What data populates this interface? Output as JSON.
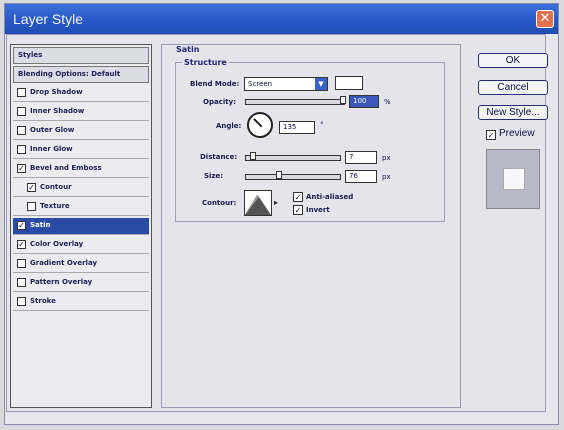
{
  "window": {
    "title": "Layer Style",
    "close_icon": "✕"
  },
  "sidebar": {
    "styles_header": "Styles",
    "blending_header": "Blending Options: Default",
    "items": [
      {
        "label": "Drop Shadow",
        "checked": false
      },
      {
        "label": "Inner Shadow",
        "checked": false
      },
      {
        "label": "Outer Glow",
        "checked": false
      },
      {
        "label": "Inner Glow",
        "checked": false
      },
      {
        "label": "Bevel and Emboss",
        "checked": true
      },
      {
        "label": "Contour",
        "checked": true,
        "sub": true
      },
      {
        "label": "Texture",
        "checked": false,
        "sub": true
      },
      {
        "label": "Satin",
        "checked": true,
        "active": true
      },
      {
        "label": "Color Overlay",
        "checked": true
      },
      {
        "label": "Gradient Overlay",
        "checked": false
      },
      {
        "label": "Pattern Overlay",
        "checked": false
      },
      {
        "label": "Stroke",
        "checked": false
      }
    ]
  },
  "panel": {
    "section_title": "Satin",
    "group_title": "Structure",
    "blend_mode_label": "Blend Mode:",
    "blend_mode_value": "Screen",
    "blend_color": "#ffffff",
    "opacity_label": "Opacity:",
    "opacity_value": "100",
    "opacity_unit": "%",
    "angle_label": "Angle:",
    "angle_value": "135",
    "angle_unit": "°",
    "distance_label": "Distance:",
    "distance_value": "7",
    "distance_unit": "px",
    "size_label": "Size:",
    "size_value": "76",
    "size_unit": "px",
    "contour_label": "Contour:",
    "anti_aliased_label": "Anti-aliased",
    "anti_aliased_checked": true,
    "invert_label": "Invert",
    "invert_checked": true
  },
  "buttons": {
    "ok": "OK",
    "cancel": "Cancel",
    "new_style": "New Style...",
    "preview_label": "Preview",
    "preview_checked": true
  },
  "colors": {
    "titlebar": "#2557c4",
    "active_item": "#2a4ca6",
    "close_button": "#e2704d"
  }
}
